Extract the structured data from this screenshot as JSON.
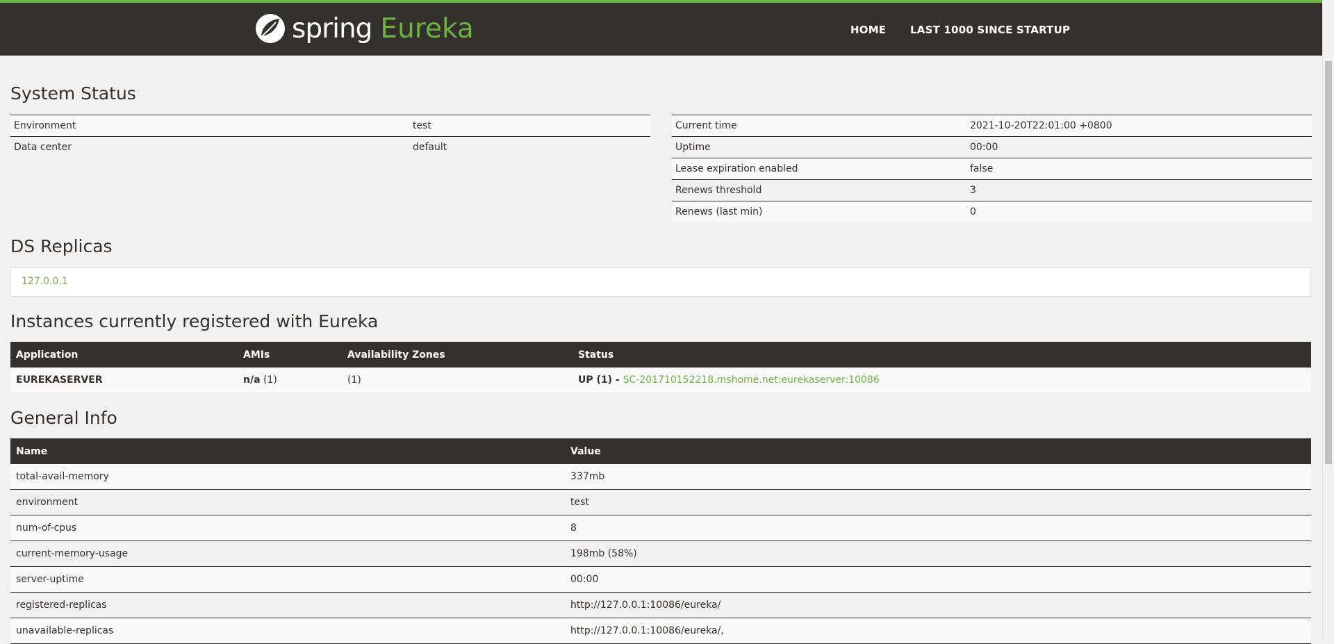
{
  "header": {
    "logo_word": "spring",
    "logo_product": "Eureka",
    "nav": [
      "HOME",
      "LAST 1000 SINCE STARTUP"
    ]
  },
  "system_status": {
    "title": "System Status",
    "left": [
      {
        "label": "Environment",
        "value": "test"
      },
      {
        "label": "Data center",
        "value": "default"
      }
    ],
    "right": [
      {
        "label": "Current time",
        "value": "2021-10-20T22:01:00 +0800"
      },
      {
        "label": "Uptime",
        "value": "00:00"
      },
      {
        "label": "Lease expiration enabled",
        "value": "false"
      },
      {
        "label": "Renews threshold",
        "value": "3"
      },
      {
        "label": "Renews (last min)",
        "value": "0"
      }
    ]
  },
  "ds_replicas": {
    "title": "DS Replicas",
    "items": [
      "127.0.0.1"
    ]
  },
  "instances": {
    "title": "Instances currently registered with Eureka",
    "columns": [
      "Application",
      "AMIs",
      "Availability Zones",
      "Status"
    ],
    "rows": [
      {
        "application": "EUREKASERVER",
        "amis_label": "n/a",
        "amis_count": "(1)",
        "zones": "(1)",
        "status_prefix": "UP (1) - ",
        "status_link": "SC-201710152218.mshome.net:eurekaserver:10086"
      }
    ]
  },
  "general_info": {
    "title": "General Info",
    "columns": [
      "Name",
      "Value"
    ],
    "rows": [
      {
        "name": "total-avail-memory",
        "value": "337mb"
      },
      {
        "name": "environment",
        "value": "test"
      },
      {
        "name": "num-of-cpus",
        "value": "8"
      },
      {
        "name": "current-memory-usage",
        "value": "198mb (58%)"
      },
      {
        "name": "server-uptime",
        "value": "00:00"
      },
      {
        "name": "registered-replicas",
        "value": "http://127.0.0.1:10086/eureka/"
      },
      {
        "name": "unavailable-replicas",
        "value": "http://127.0.0.1:10086/eureka/,"
      }
    ]
  },
  "colors": {
    "brand_green": "#6db33f",
    "header_dark": "#34302d",
    "page_bg": "#f1f1f1"
  }
}
